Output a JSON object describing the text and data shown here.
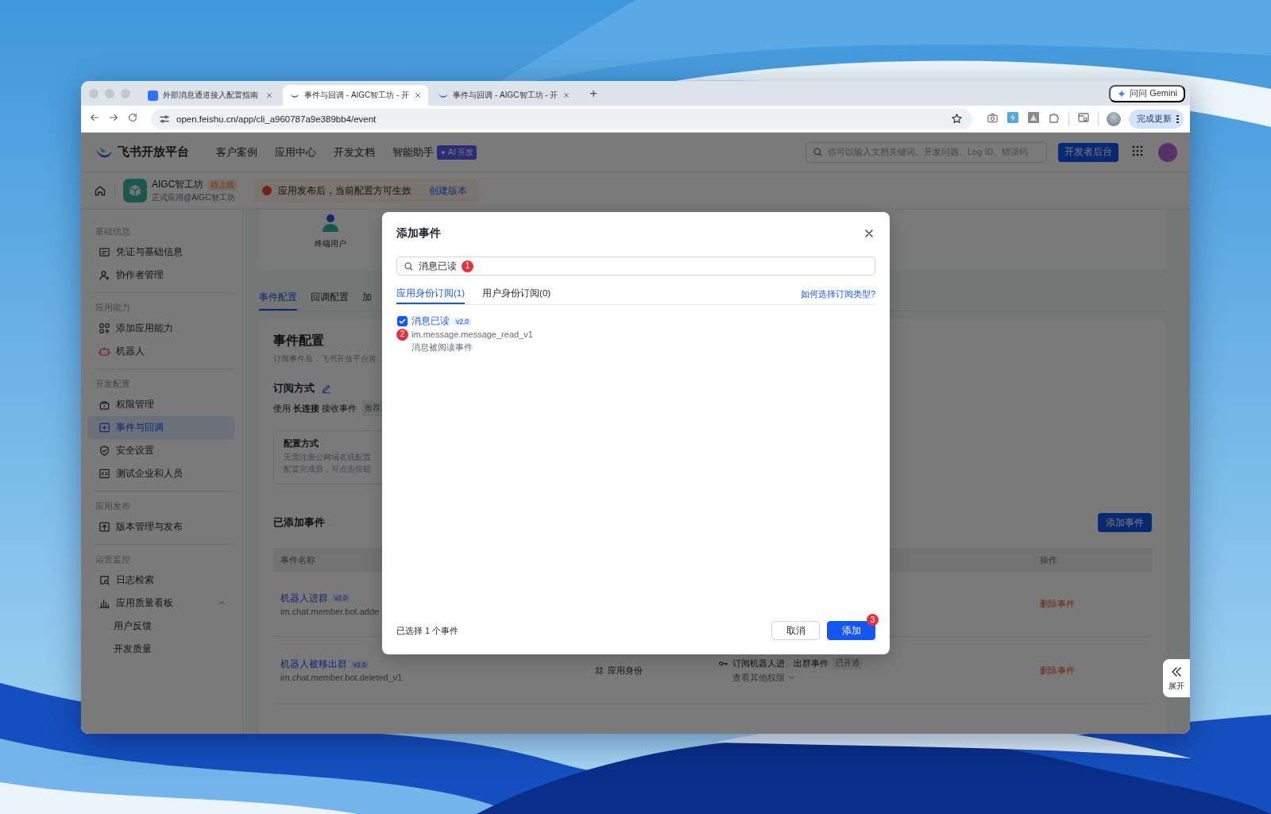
{
  "browser": {
    "tabs": [
      {
        "title": "外部消息通道接入配置指南",
        "selected": false
      },
      {
        "title": "事件与回调 - AIGC智工坊 - 开",
        "selected": true
      },
      {
        "title": "事件与回调 - AIGC智工坊 - 开",
        "selected": false
      }
    ],
    "new_tab": "+",
    "gemini_button": "问问 Gemini",
    "url": "open.feishu.cn/app/cli_a960787a9e389bb4/event",
    "update_button": "完成更新"
  },
  "header": {
    "logo": "飞书开放平台",
    "nav": [
      {
        "label": "客户案例"
      },
      {
        "label": "应用中心"
      },
      {
        "label": "开发文档"
      },
      {
        "label": "智能助手",
        "badge": "AI 开发"
      }
    ],
    "search": {
      "placeholder": "你可以输入文档关键词、开发问题、Log ID、错误码"
    },
    "console_button": "开发者后台"
  },
  "app_bar": {
    "app_name": "AIGC智工坊",
    "status": "待上线",
    "subtitle": "正式应用@AIGC智工坊",
    "notice": "应用发布后，当前配置方可生效",
    "notice_link": "创建版本"
  },
  "sidebar": {
    "sections": [
      {
        "title": "基础信息",
        "items": [
          {
            "label": "凭证与基础信息",
            "selected": false
          },
          {
            "label": "协作者管理",
            "selected": false
          }
        ]
      },
      {
        "title": "应用能力",
        "items": [
          {
            "label": "添加应用能力",
            "selected": false
          },
          {
            "label": "机器人",
            "selected": false
          }
        ]
      },
      {
        "title": "开发配置",
        "items": [
          {
            "label": "权限管理",
            "selected": false
          },
          {
            "label": "事件与回调",
            "selected": true
          },
          {
            "label": "安全设置",
            "selected": false
          },
          {
            "label": "测试企业和人员",
            "selected": false
          }
        ]
      },
      {
        "title": "应用发布",
        "items": [
          {
            "label": "版本管理与发布",
            "selected": false
          }
        ]
      },
      {
        "title": "运营监控",
        "items": [
          {
            "label": "日志检索",
            "selected": false
          },
          {
            "label": "应用质量看板",
            "selected": false,
            "expanded": true,
            "children": [
              {
                "label": "用户反馈",
                "selected": false
              },
              {
                "label": "开发质量",
                "selected": false
              }
            ]
          }
        ]
      }
    ]
  },
  "main": {
    "diagram_label": "终端用户",
    "tabs": [
      {
        "label": "事件配置",
        "selected": true
      },
      {
        "label": "回调配置",
        "selected": false
      },
      {
        "label": "加",
        "selected": false
      }
    ],
    "section_title": "事件配置",
    "section_desc": "订阅事件后，飞书开放平台将",
    "subscription_title": "订阅方式",
    "subscription_text": "使用 **长连接** 接收事件",
    "subscription_tag": "推荐",
    "config_card": {
      "title": "配置方式",
      "lines": [
        "无需注册公网域名或配置",
        "配置完成后，可点击按钮"
      ]
    },
    "added_title": "已添加事件",
    "add_button": "添加事件",
    "table": {
      "columns": [
        {
          "label": "事件名称"
        },
        {
          "label": "操作"
        }
      ],
      "rows": [
        {
          "name": "机器人进群",
          "version": "v2.0",
          "code": "im.chat.member.bot.adde",
          "action": "删除事件"
        },
        {
          "name": "机器人被移出群",
          "version": "v2.0",
          "code": "im.chat.member.bot.deleted_v1",
          "identity": "应用身份",
          "permission": "订阅机器人进、出群事件",
          "permission_tag": "已开通",
          "more": "查看其他权限",
          "action": "删除事件"
        }
      ]
    }
  },
  "expand_panel": {
    "label": "展开"
  },
  "modal": {
    "title": "添加事件",
    "search_value": "消息已读",
    "search_badge": "1",
    "tabs": [
      {
        "label": "应用身份订阅(1)",
        "selected": true
      },
      {
        "label": "用户身份订阅(0)",
        "selected": false
      }
    ],
    "help_link": "如何选择订阅类型?",
    "events": [
      {
        "name": "消息已读",
        "version": "v2.0",
        "code": "im.message.message_read_v1",
        "description": "消息被阅读事件",
        "checked": true,
        "badge": "2"
      }
    ],
    "footer": "已选择 1 个事件",
    "cancel_button": "取消",
    "add_button": "添加",
    "add_badge": "3"
  }
}
